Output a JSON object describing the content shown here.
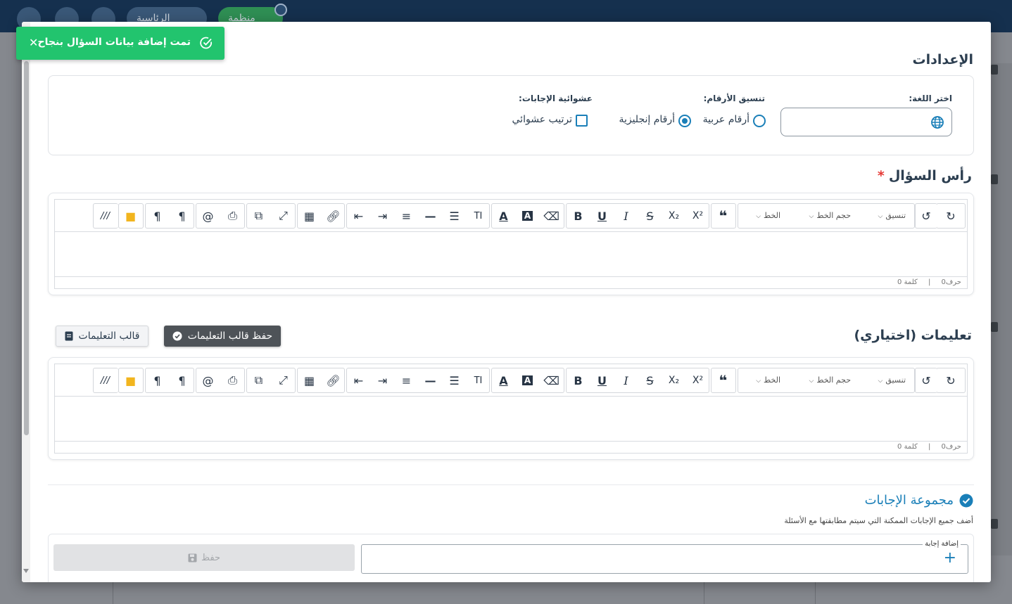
{
  "background": {
    "pills": [
      "الرئاسية",
      "منظمة"
    ]
  },
  "toast": {
    "message": "تمت إضافة بيانات السؤال بنجاح",
    "close_icon": "close-icon",
    "status_icon": "check-circle-icon"
  },
  "settings": {
    "title": "الإعدادات",
    "language_label": "اختر اللغة:",
    "language_value": "",
    "number_format_label": "تنسيق الأرقام:",
    "number_format_options": [
      "أرقام عربية",
      "أرقام إنجليزية"
    ],
    "number_format_selected": "أرقام إنجليزية",
    "randomness_label": "عشوائية الإجابات:",
    "randomness_option": "ترتيب عشوائي",
    "randomness_checked": false
  },
  "question_head": {
    "title": "رأس السؤال",
    "required_mark": "*"
  },
  "editor": {
    "format_select": "تنسيق",
    "font_size_select": "حجم الخط",
    "font_select": "الخط",
    "chars_status": "حرف0",
    "words_status": "كلمة 0",
    "separator": "|"
  },
  "instructions": {
    "title": "تعليمات (اختياري)",
    "save_template_button": "حفظ قالب التعليمات",
    "template_button": "قالب التعليمات"
  },
  "answers": {
    "title": "مجموعة الإجابات",
    "subtitle": "أضف جميع الإجابات الممكنة التي سيتم مطابقتها مع الأسئلة",
    "add_answer_label": "إضافة إجابة",
    "add_answer_value": "",
    "save_button": "حفظ"
  },
  "colors": {
    "accent": "#1a7fb8",
    "toast_success": "#22c46e",
    "header": "#15304e"
  }
}
